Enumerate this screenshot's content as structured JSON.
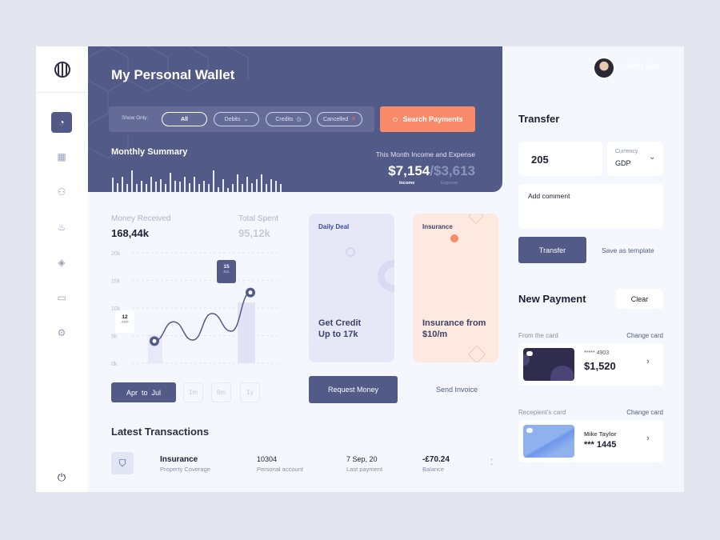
{
  "header": {
    "title": "My Personal Wallet",
    "user_name": "John Doe",
    "filter_label": "Show Only:",
    "filters": [
      "All",
      "Debits",
      "Credits",
      "Cancelled"
    ],
    "search_button": "Search Payments",
    "summary_title": "Monthly Summary",
    "income_expense_title": "This Month Income and Expense",
    "income": "$7,154",
    "expense": "/$3,613",
    "income_label": "Income",
    "expense_label": "Expense",
    "monthly_bars": [
      0.55,
      0.35,
      0.6,
      0.3,
      0.85,
      0.3,
      0.45,
      0.3,
      0.6,
      0.4,
      0.5,
      0.3,
      0.75,
      0.45,
      0.4,
      0.6,
      0.35,
      0.6,
      0.3,
      0.45,
      0.3,
      0.85,
      0.2,
      0.5,
      0.15,
      0.3,
      0.7,
      0.3,
      0.6,
      0.35,
      0.5,
      0.7,
      0.3,
      0.5,
      0.45,
      0.3
    ]
  },
  "stats": {
    "received_label": "Money Received",
    "received_value": "168,44k",
    "spent_label": "Total Spent",
    "spent_value": "95,12k"
  },
  "chart_data": {
    "type": "line",
    "y_ticks": [
      "20k",
      "15k",
      "10k",
      "5k",
      "0k"
    ],
    "ylim": [
      0,
      20000
    ],
    "points": [
      {
        "label": "Apr",
        "value": 4000
      },
      {
        "label": "",
        "value": 7500
      },
      {
        "label": "",
        "value": 4200
      },
      {
        "label": "",
        "value": 9000
      },
      {
        "label": "",
        "value": 5800
      },
      {
        "label": "Jul",
        "value": 12800
      }
    ],
    "tooltips": [
      {
        "day": "12",
        "month": "ARP"
      },
      {
        "day": "15",
        "month": "JUL"
      }
    ]
  },
  "range": {
    "selected": "Apr  to  Jul",
    "options": [
      "1m",
      "6m",
      "1y"
    ]
  },
  "deals": {
    "daily_title": "Daily Deal",
    "daily_text1": "Get Credit",
    "daily_text2": "Up to 17k",
    "ins_title": "Insurance",
    "ins_text1": "Insurance from",
    "ins_text2": "$10/m",
    "request_button": "Request Money",
    "invoice_link": "Send Invoice"
  },
  "transactions": {
    "title": "Latest Transactions",
    "rows": [
      {
        "name": "Insurance",
        "sub": "Property Coverage",
        "id": "10304",
        "id_sub": "Personal account",
        "date": "7 Sep, 20",
        "date_sub": "Last payment",
        "amount": "-£70.24",
        "amount_sub": "Balance"
      }
    ]
  },
  "transfer": {
    "title": "Transfer",
    "amount": "205",
    "currency_label": "Currency",
    "currency": "GDP",
    "comment_placeholder": "Add comment",
    "transfer_button": "Transfer",
    "template_link": "Save as template"
  },
  "new_payment": {
    "title": "New Payment",
    "clear_button": "Clear",
    "from_label": "From the card",
    "change": "Change card",
    "from_number": "***** 4903",
    "from_balance": "$1,520",
    "to_label": "Recepient's card",
    "to_name": "Mike Taylor",
    "to_number": "*** 1445"
  },
  "colors": {
    "primary": "#525a87",
    "accent": "#f98b6a",
    "bg": "#f4f7fd"
  }
}
